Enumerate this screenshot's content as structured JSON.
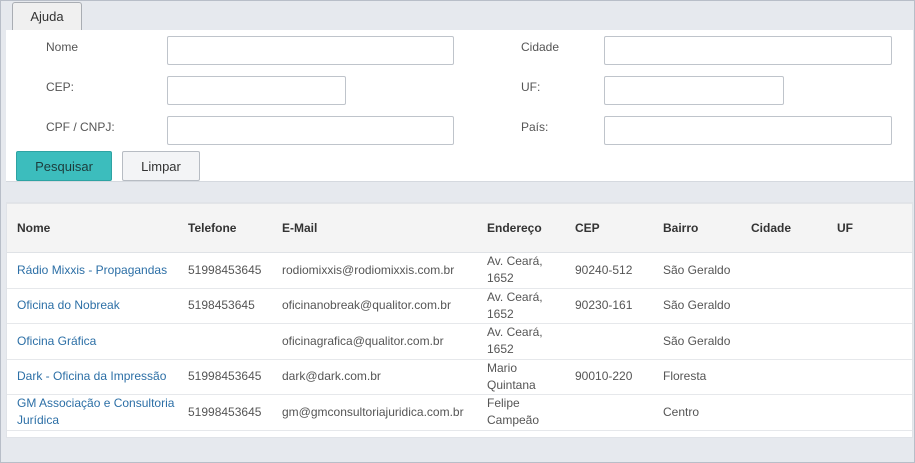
{
  "toolbar": {
    "help_label": "Ajuda"
  },
  "filters": {
    "nome_label": "Nome",
    "cidade_label": "Cidade",
    "cep_label": "CEP:",
    "uf_label": "UF:",
    "cpf_label": "CPF / CNPJ:",
    "pais_label": "País:",
    "nome_value": "",
    "cidade_value": "",
    "cep_value": "",
    "uf_value": "",
    "cpf_value": "",
    "pais_value": ""
  },
  "actions": {
    "search_label": "Pesquisar",
    "clear_label": "Limpar"
  },
  "colors": {
    "search_button": "#3cbdbd",
    "link": "#2c6fa6"
  },
  "table": {
    "headers": [
      "Nome",
      "Telefone",
      "E-Mail",
      "Endereço",
      "CEP",
      "Bairro",
      "Cidade",
      "UF"
    ],
    "rows": [
      {
        "nome": "Rádio Mixxis - Propagandas",
        "telefone": "51998453645",
        "email": "rodiomixxis@rodiomixxis.com.br",
        "endereco": "Av. Ceará, 1652",
        "cep": "90240-512",
        "bairro": "São Geraldo",
        "cidade": "",
        "uf": ""
      },
      {
        "nome": "Oficina do Nobreak",
        "telefone": "5198453645",
        "email": "oficinanobreak@qualitor.com.br",
        "endereco": "Av. Ceará, 1652",
        "cep": "90230-161",
        "bairro": "São Geraldo",
        "cidade": "",
        "uf": ""
      },
      {
        "nome": "Oficina Gráfica",
        "telefone": "",
        "email": "oficinagrafica@qualitor.com.br",
        "endereco": "Av. Ceará, 1652",
        "cep": "",
        "bairro": "São Geraldo",
        "cidade": "",
        "uf": ""
      },
      {
        "nome": "Dark - Oficina da Impressão",
        "telefone": "51998453645",
        "email": "dark@dark.com.br",
        "endereco": "Mario Quintana",
        "cep": "90010-220",
        "bairro": "Floresta",
        "cidade": "",
        "uf": ""
      },
      {
        "nome": "GM Associação e Consultoria Jurídica",
        "telefone": "51998453645",
        "email": "gm@gmconsultoriajuridica.com.br",
        "endereco": "Felipe Campeão",
        "cep": "",
        "bairro": "Centro",
        "cidade": "",
        "uf": ""
      }
    ]
  }
}
